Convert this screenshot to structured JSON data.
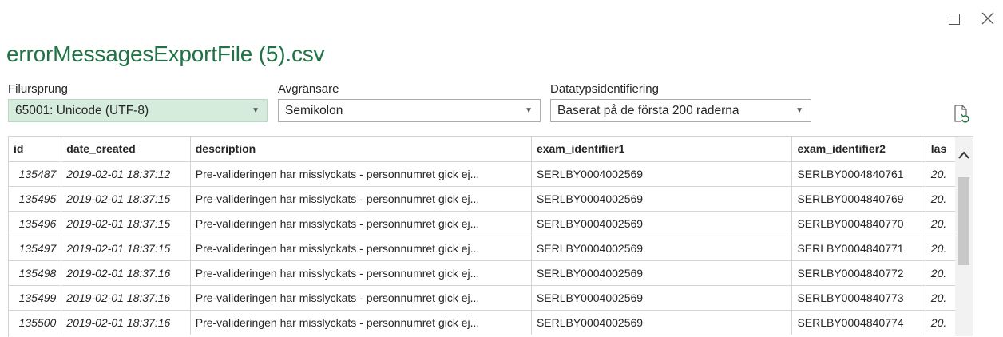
{
  "window": {
    "title": "errorMessagesExportFile (5).csv",
    "maximize_icon": "maximize-icon",
    "close_icon": "close-icon"
  },
  "options": {
    "file_origin": {
      "label": "Filursprung",
      "value": "65001: Unicode (UTF-8)"
    },
    "delimiter": {
      "label": "Avgränsare",
      "value": "Semikolon"
    },
    "data_type_detection": {
      "label": "Datatypsidentifiering",
      "value": "Baserat på de första 200 raderna"
    },
    "refresh_icon": "refresh-file-icon"
  },
  "table": {
    "headers": [
      "id",
      "date_created",
      "description",
      "exam_identifier1",
      "exam_identifier2",
      "las"
    ],
    "rows": [
      [
        "135487",
        "2019-02-01 18:37:12",
        "Pre-valideringen har misslyckats - personnumret gick ej...",
        "SERLBY0004002569",
        "SERLBY0004840761",
        "20."
      ],
      [
        "135495",
        "2019-02-01 18:37:15",
        "Pre-valideringen har misslyckats - personnumret gick ej...",
        "SERLBY0004002569",
        "SERLBY0004840769",
        "20."
      ],
      [
        "135496",
        "2019-02-01 18:37:15",
        "Pre-valideringen har misslyckats - personnumret gick ej...",
        "SERLBY0004002569",
        "SERLBY0004840770",
        "20."
      ],
      [
        "135497",
        "2019-02-01 18:37:15",
        "Pre-valideringen har misslyckats - personnumret gick ej...",
        "SERLBY0004002569",
        "SERLBY0004840771",
        "20."
      ],
      [
        "135498",
        "2019-02-01 18:37:16",
        "Pre-valideringen har misslyckats - personnumret gick ej...",
        "SERLBY0004002569",
        "SERLBY0004840772",
        "20."
      ],
      [
        "135499",
        "2019-02-01 18:37:16",
        "Pre-valideringen har misslyckats - personnumret gick ej...",
        "SERLBY0004002569",
        "SERLBY0004840773",
        "20."
      ],
      [
        "135500",
        "2019-02-01 18:37:16",
        "Pre-valideringen har misslyckats - personnumret gick ej...",
        "SERLBY0004002569",
        "SERLBY0004840774",
        "20."
      ]
    ]
  },
  "colors": {
    "title": "#217346",
    "selected_dropdown": "#d5ecdc"
  }
}
